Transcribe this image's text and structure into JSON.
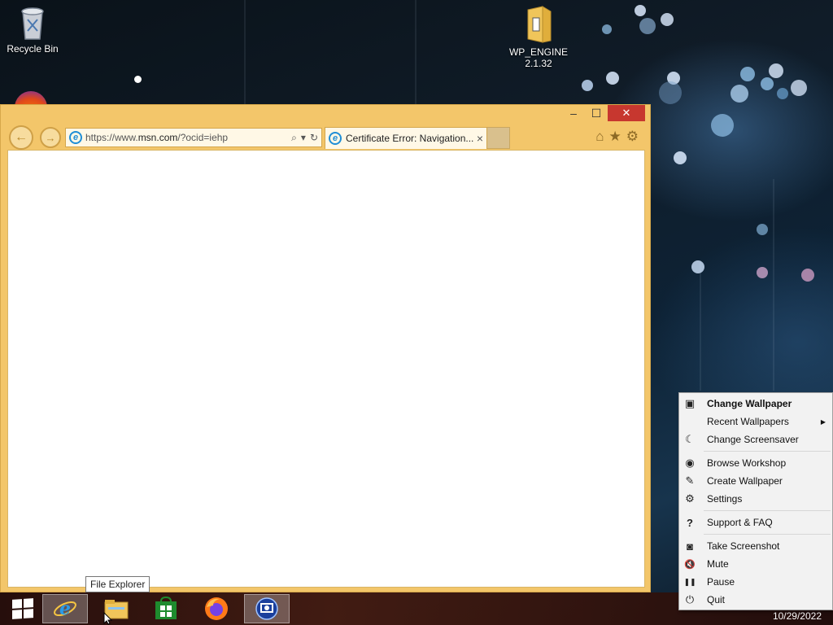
{
  "desktop": {
    "icons": [
      {
        "label": "Recycle Bin",
        "icon": "recycle-bin-icon"
      },
      {
        "label": "WP_ENGINE 2.1.32",
        "label_line1": "WP_ENGINE",
        "label_line2": "2.1.32",
        "icon": "folder-icon"
      }
    ]
  },
  "browser": {
    "url_prefix": "https://www.",
    "url_domain": "msn.com",
    "url_suffix": "/?ocid=iehp",
    "tab_title": "Certificate Error: Navigation...",
    "tab_close": "×",
    "window_minimize": "–",
    "window_maximize": "☐",
    "window_close": "✕",
    "back_glyph": "←",
    "forward_glyph": "→",
    "search_glyph": "⌕",
    "dropdown_glyph": "▾",
    "refresh_glyph": "↻",
    "home_glyph": "⌂",
    "favorites_glyph": "★",
    "settings_glyph": "⚙"
  },
  "taskbar": {
    "items": [
      "start-icon",
      "internet-explorer-icon",
      "file-explorer-icon",
      "store-icon",
      "firefox-icon",
      "remote-desktop-icon"
    ],
    "tooltip": "File Explorer",
    "clock_date": "10/29/2022"
  },
  "context_menu": {
    "items": [
      {
        "label": "Change Wallpaper",
        "icon": "image-icon",
        "glyph": "▣"
      },
      {
        "label": "Recent Wallpapers",
        "icon": "",
        "glyph": "",
        "submenu_arrow": "▶"
      },
      {
        "label": "Change Screensaver",
        "icon": "moon-icon",
        "glyph": "☾"
      },
      {
        "label": "Browse Workshop",
        "icon": "steam-icon",
        "glyph": "◉"
      },
      {
        "label": "Create Wallpaper",
        "icon": "magic-wand-icon",
        "glyph": "✎"
      },
      {
        "label": "Settings",
        "icon": "gear-icon",
        "glyph": "⚙"
      },
      {
        "label": "Support & FAQ",
        "icon": "question-icon",
        "glyph": "?"
      },
      {
        "label": "Take Screenshot",
        "icon": "camera-icon",
        "glyph": "◙"
      },
      {
        "label": "Mute",
        "icon": "mute-icon",
        "glyph": "🔇"
      },
      {
        "label": "Pause",
        "icon": "pause-icon",
        "glyph": "❚❚"
      },
      {
        "label": "Quit",
        "icon": "power-icon",
        "glyph": "⏻"
      }
    ]
  },
  "colors": {
    "window_frame": "#f3c66a",
    "close_button": "#c7372f",
    "ie_blue": "#1f8ed6"
  }
}
